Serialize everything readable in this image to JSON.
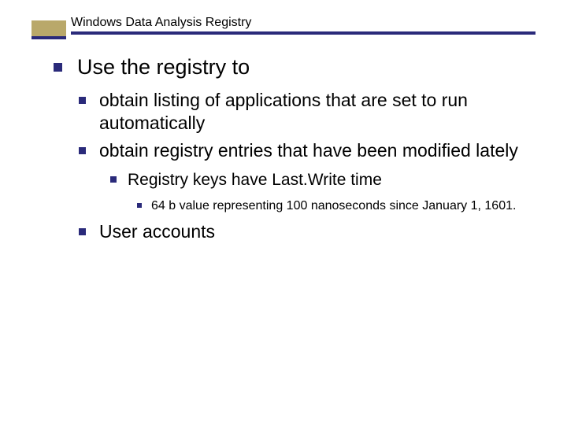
{
  "title": "Windows Data Analysis Registry",
  "bullets": {
    "l1": "Use the registry to",
    "l2a": "obtain listing of applications that are set to run automatically",
    "l2b": "obtain registry entries that have been modified lately",
    "l3": "Registry keys have Last.Write time",
    "l4": "64 b value representing 100 nanoseconds since January 1, 1601.",
    "l2c": "User accounts"
  },
  "colors": {
    "accent_navy": "#2a2a7a",
    "accent_gold": "#b9a86a"
  }
}
